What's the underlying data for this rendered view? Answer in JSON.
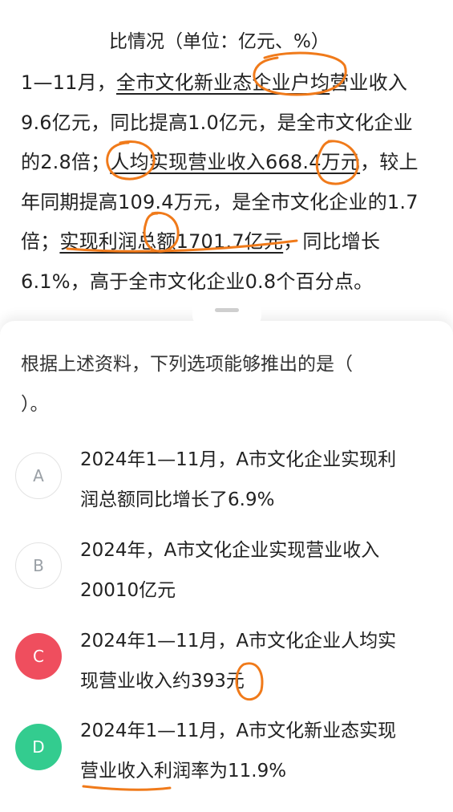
{
  "passage": {
    "table_caption": "比情况（单位：亿元、%）",
    "line1_a": "1—11月，",
    "line1_b": "全市文化新业态企业户均",
    "line1_c": "营业收入",
    "line2": "9.6亿元，同比提高1.0亿元，是全市文化企业",
    "line3_a": "的2.8倍；",
    "line3_b": "人均实现营业收入668.4万元",
    "line3_c": "，较上",
    "line4": "年同期提高109.4万元，是全市文化企业的1.7",
    "line5_a": "倍；",
    "line5_b": "实现利润总额1701.7亿元",
    "line5_c": "，同比增长",
    "line6": "6.1%，高于全市文化企业0.8个百分点。"
  },
  "question": {
    "line1": "根据上述资料，下列选项能够推出的是（",
    "line2": "）。"
  },
  "options": [
    {
      "letter": "A",
      "line1": "2024年1—11月，A市文化企业实现利",
      "line2": "润总额同比增长了6.9%",
      "state": "default"
    },
    {
      "letter": "B",
      "line1": "2024年，A市文化企业实现营业收入",
      "line2": "20010亿元",
      "state": "default"
    },
    {
      "letter": "C",
      "line1": "2024年1—11月，A市文化企业人均实",
      "line2": "现营业收入约393元",
      "state": "wrong"
    },
    {
      "letter": "D",
      "line1": "2024年1—11月，A市文化新业态实现",
      "line2": "营业收入利润率为11.9%",
      "state": "correct"
    }
  ],
  "colors": {
    "wrong": "#ef4e5e",
    "correct": "#33cc8f",
    "annotation": "#f07a1a"
  }
}
